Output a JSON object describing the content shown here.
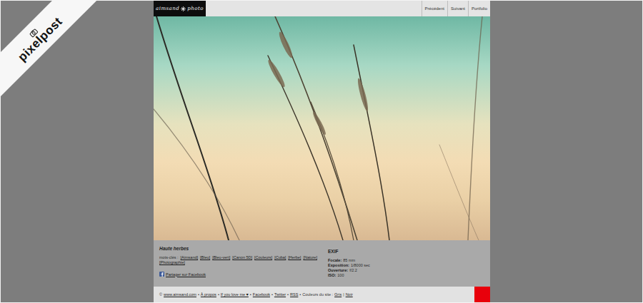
{
  "ribbon": {
    "label": "pixelpost"
  },
  "logo": {
    "left": "aimsand",
    "right": "photo"
  },
  "nav": [
    {
      "label": "Précédent"
    },
    {
      "label": "Suivant"
    },
    {
      "label": "Portfolio"
    }
  ],
  "post": {
    "title": "Haute herbes",
    "tags_label": "mots-clés :",
    "tags": [
      "[Aimsand]",
      "[Bleu]",
      "[Bleu-vert]",
      "[Canon 5D]",
      "[Couleurs]",
      "[Cuba]",
      "[Herbe]",
      "[Nature]",
      "[Photographie]"
    ],
    "share": "Partager sur Facebook"
  },
  "exif": {
    "title": "EXIF",
    "rows": [
      {
        "label": "Focale:",
        "value": "85 mm"
      },
      {
        "label": "Exposition:",
        "value": "1/8000 sec"
      },
      {
        "label": "Ouverture:",
        "value": "f/2.2"
      },
      {
        "label": "ISO:",
        "value": "100"
      }
    ]
  },
  "footer": {
    "segments": [
      {
        "text": "©",
        "kind": "text"
      },
      {
        "text": "www.aimsand.com",
        "kind": "link"
      },
      {
        "text": "•",
        "kind": "sep"
      },
      {
        "text": "À propos",
        "kind": "link"
      },
      {
        "text": "•",
        "kind": "sep"
      },
      {
        "text": "If you love me ♥",
        "kind": "link"
      },
      {
        "text": "•",
        "kind": "sep"
      },
      {
        "text": "Facebook",
        "kind": "link"
      },
      {
        "text": "•",
        "kind": "sep"
      },
      {
        "text": "Twitter",
        "kind": "link"
      },
      {
        "text": "•",
        "kind": "sep"
      },
      {
        "text": "RSS",
        "kind": "link"
      },
      {
        "text": "•",
        "kind": "sep"
      },
      {
        "text": "Couleurs du site :",
        "kind": "text"
      },
      {
        "text": "Gris",
        "kind": "link"
      },
      {
        "text": "|",
        "kind": "sep"
      },
      {
        "text": "Noir",
        "kind": "link"
      }
    ]
  }
}
